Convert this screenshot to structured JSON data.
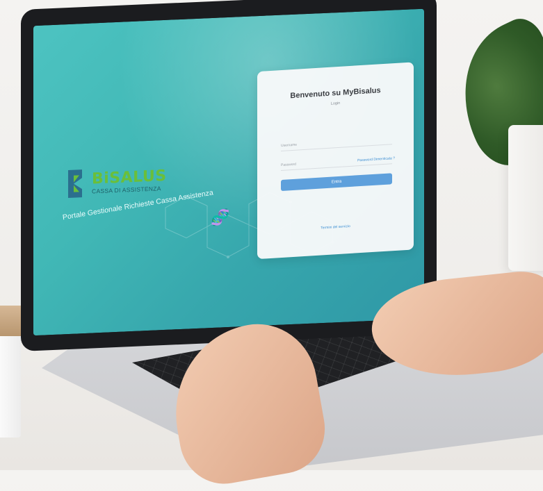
{
  "brand": {
    "name": "BiSALUS",
    "subtitle": "CASSA DI ASSISTENZA",
    "tagline": "Portale Gestionale Richieste Cassa Assistenza",
    "colors": {
      "green": "#6abf3a",
      "blue": "#2b6f8e"
    }
  },
  "login": {
    "title": "Benvenuto su MyBisalus",
    "subtitle": "Login",
    "username_placeholder": "Username",
    "password_placeholder": "Password",
    "forgot_label": "Password Dimenticata ?",
    "enter_label": "Entra",
    "terms_label": "Termini del servizio"
  },
  "theme": {
    "screen_bg": "#41b8b6",
    "button_bg": "#5ea0dc",
    "link_color": "#3d8fd3"
  },
  "icons": {
    "logo": "bisalus-logo-icon",
    "dna": "dna-helix-icon"
  }
}
